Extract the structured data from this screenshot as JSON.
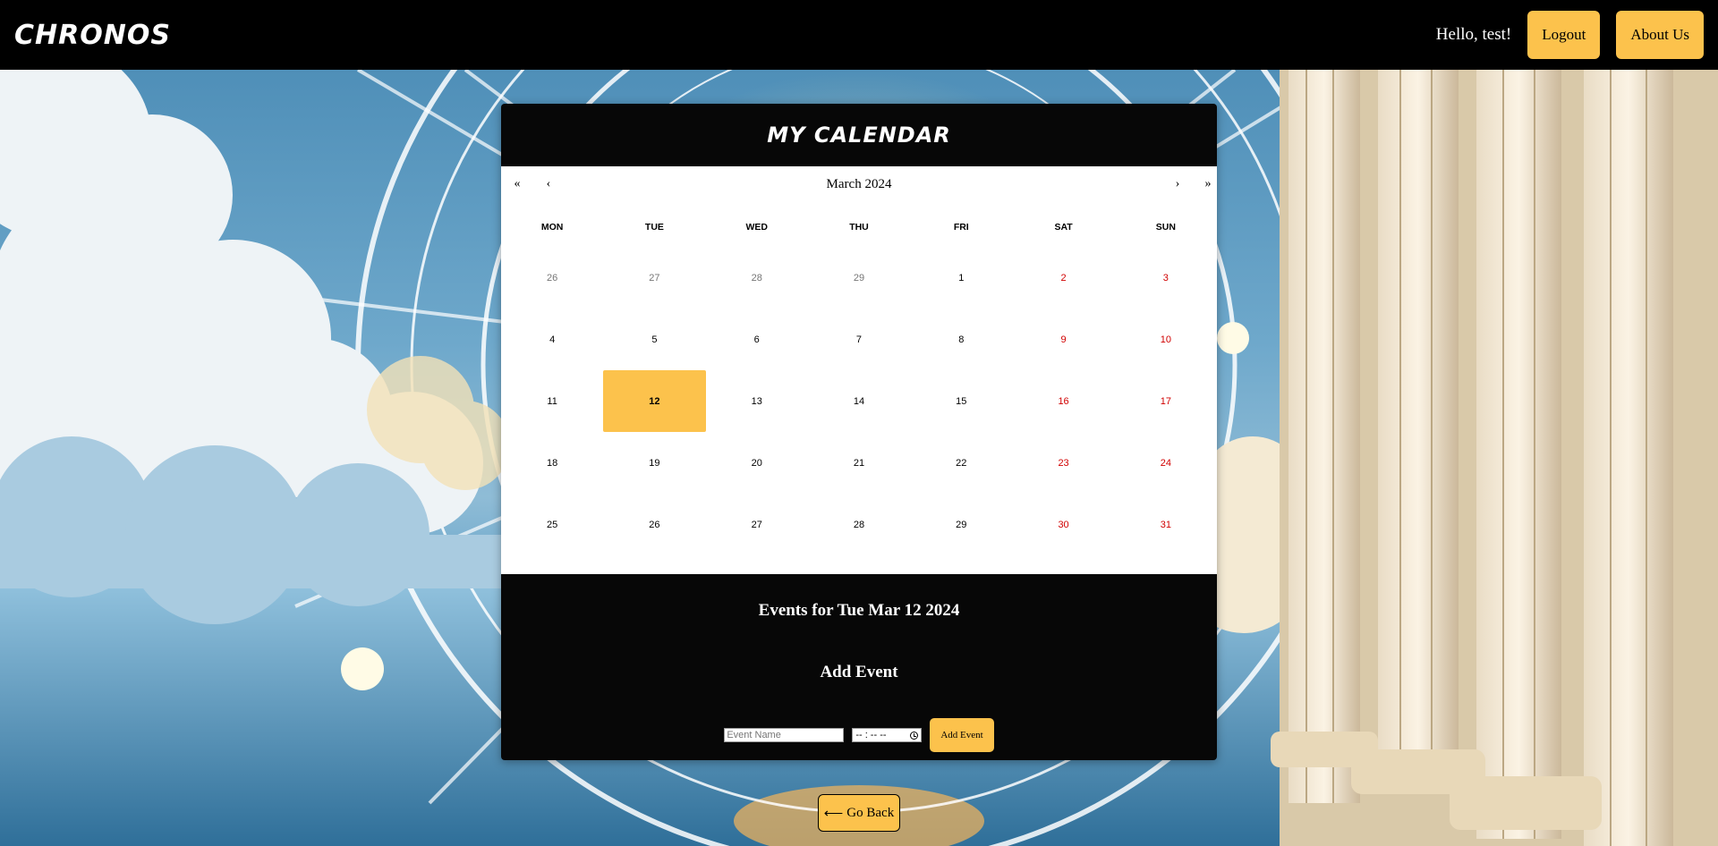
{
  "header": {
    "logo": "CHRONOS",
    "greeting": "Hello, test!",
    "logout_label": "Logout",
    "about_label": "About Us"
  },
  "calendar": {
    "title": "MY CALENDAR",
    "month_label": "March 2024",
    "nav": {
      "prev_year": "«",
      "prev_month": "‹",
      "next_month": "›",
      "next_year": "»"
    },
    "weekdays": [
      "MON",
      "TUE",
      "WED",
      "THU",
      "FRI",
      "SAT",
      "SUN"
    ],
    "weeks": [
      [
        {
          "d": "26",
          "t": "other"
        },
        {
          "d": "27",
          "t": "other"
        },
        {
          "d": "28",
          "t": "other"
        },
        {
          "d": "29",
          "t": "other"
        },
        {
          "d": "1",
          "t": "normal"
        },
        {
          "d": "2",
          "t": "weekend"
        },
        {
          "d": "3",
          "t": "weekend"
        }
      ],
      [
        {
          "d": "4",
          "t": "normal"
        },
        {
          "d": "5",
          "t": "normal"
        },
        {
          "d": "6",
          "t": "normal"
        },
        {
          "d": "7",
          "t": "normal"
        },
        {
          "d": "8",
          "t": "normal"
        },
        {
          "d": "9",
          "t": "weekend"
        },
        {
          "d": "10",
          "t": "weekend"
        }
      ],
      [
        {
          "d": "11",
          "t": "normal"
        },
        {
          "d": "12",
          "t": "selected"
        },
        {
          "d": "13",
          "t": "normal"
        },
        {
          "d": "14",
          "t": "normal"
        },
        {
          "d": "15",
          "t": "normal"
        },
        {
          "d": "16",
          "t": "weekend"
        },
        {
          "d": "17",
          "t": "weekend"
        }
      ],
      [
        {
          "d": "18",
          "t": "normal"
        },
        {
          "d": "19",
          "t": "normal"
        },
        {
          "d": "20",
          "t": "normal"
        },
        {
          "d": "21",
          "t": "normal"
        },
        {
          "d": "22",
          "t": "normal"
        },
        {
          "d": "23",
          "t": "weekend"
        },
        {
          "d": "24",
          "t": "weekend"
        }
      ],
      [
        {
          "d": "25",
          "t": "normal"
        },
        {
          "d": "26",
          "t": "normal"
        },
        {
          "d": "27",
          "t": "normal"
        },
        {
          "d": "28",
          "t": "normal"
        },
        {
          "d": "29",
          "t": "normal"
        },
        {
          "d": "30",
          "t": "weekend"
        },
        {
          "d": "31",
          "t": "weekend"
        }
      ]
    ]
  },
  "events": {
    "title": "Events for Tue Mar 12 2024",
    "add_title": "Add Event",
    "name_placeholder": "Event Name",
    "time_value": "-- : --  --",
    "add_button": "Add Event"
  },
  "back_button": {
    "arrow": "⟵",
    "label": "Go Back"
  },
  "colors": {
    "accent": "#fcc24c",
    "header_bg": "#000000",
    "weekend": "#d10000",
    "other_month": "#757575"
  }
}
